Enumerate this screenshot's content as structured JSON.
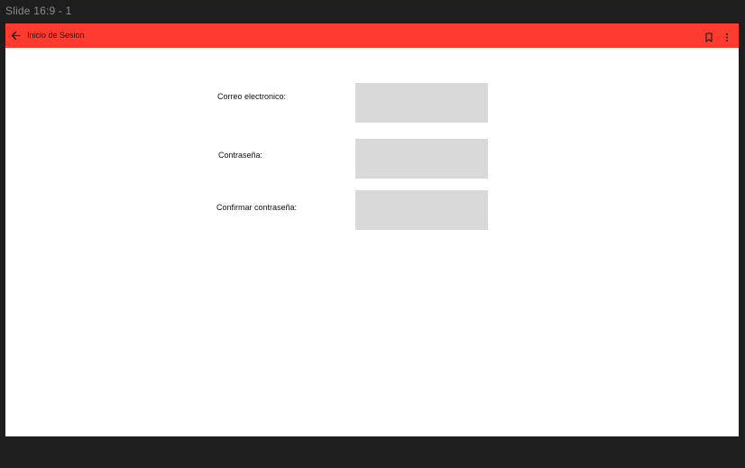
{
  "canvas": {
    "frame_label": "Slide 16:9 - 1"
  },
  "appbar": {
    "title": "Inicio de Sesion",
    "background": "#ff3b30",
    "back_icon": "arrow-left-icon",
    "bookmark_icon": "bookmark-icon",
    "more_icon": "more-vertical-icon"
  },
  "form": {
    "fields": [
      {
        "label": "Correo electronico:",
        "value": ""
      },
      {
        "label": "Contraseña:",
        "value": ""
      },
      {
        "label": "Confirmar contraseña:",
        "value": ""
      }
    ],
    "field_color": "#d9d9d9"
  }
}
